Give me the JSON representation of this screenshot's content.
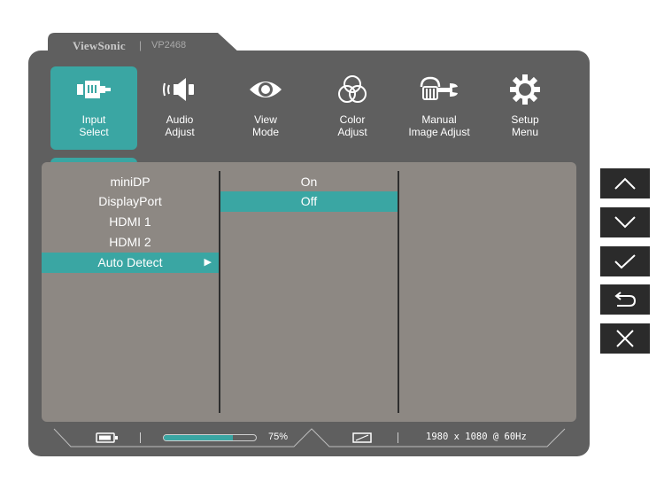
{
  "brand": "ViewSonic",
  "separator": "|",
  "model": "VP2468",
  "menu": [
    {
      "id": "input-select",
      "label_line1": "Input",
      "label_line2": "Select",
      "icon": "input-plug-icon",
      "active": true
    },
    {
      "id": "audio-adjust",
      "label_line1": "Audio",
      "label_line2": "Adjust",
      "icon": "speaker-icon",
      "active": false
    },
    {
      "id": "view-mode",
      "label_line1": "View",
      "label_line2": "Mode",
      "icon": "eye-icon",
      "active": false
    },
    {
      "id": "color-adjust",
      "label_line1": "Color",
      "label_line2": "Adjust",
      "icon": "color-circles-icon",
      "active": false
    },
    {
      "id": "manual-image-adjust",
      "label_line1": "Manual",
      "label_line2": "Image Adjust",
      "icon": "hand-wrench-icon",
      "active": false
    },
    {
      "id": "setup-menu",
      "label_line1": "Setup",
      "label_line2": "Menu",
      "icon": "gear-icon",
      "active": false
    }
  ],
  "submenu": {
    "items": [
      "miniDP",
      "DisplayPort",
      "HDMI 1",
      "HDMI 2",
      "Auto Detect"
    ],
    "selected_index": 4,
    "selected_arrow": "▶"
  },
  "options": {
    "items": [
      "On",
      "Off"
    ],
    "selected_index": 1
  },
  "status": {
    "battery_icon": "battery-icon",
    "progress_percent": 75,
    "progress_label": "75%",
    "aspect_icon": "aspect-ratio-icon",
    "resolution": "1980 x 1080 @ 60Hz"
  },
  "side_buttons": [
    "up-icon",
    "down-icon",
    "check-icon",
    "back-icon",
    "close-icon"
  ],
  "colors": {
    "accent": "#3aa6a3",
    "frame": "#5f5f5f",
    "panel": "#8d8883",
    "button": "#2b2b2b"
  }
}
